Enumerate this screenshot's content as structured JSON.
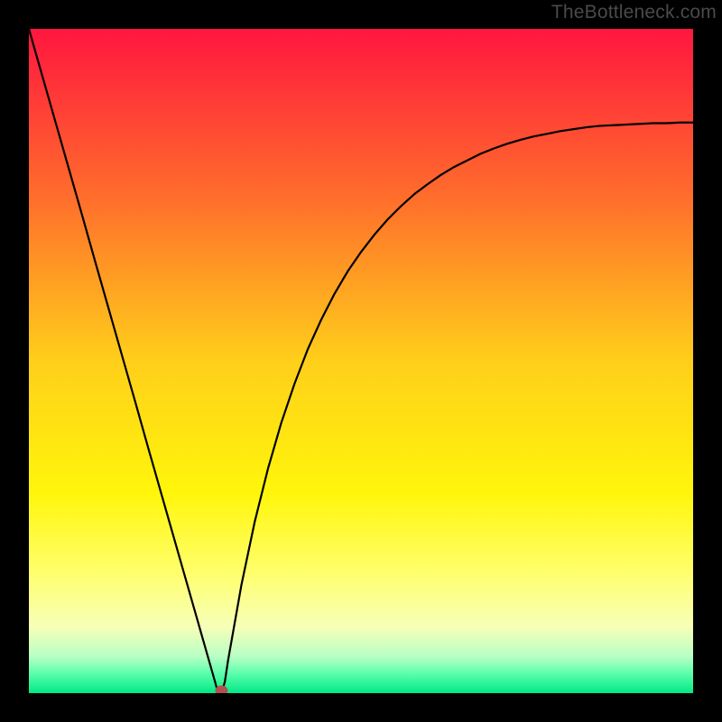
{
  "watermark": "TheBottleneck.com",
  "chart_data": {
    "type": "line",
    "title": "",
    "xlabel": "",
    "ylabel": "",
    "x": [
      0.0,
      0.02,
      0.04,
      0.06,
      0.08,
      0.1,
      0.12,
      0.14,
      0.16,
      0.18,
      0.2,
      0.22,
      0.24,
      0.26,
      0.28,
      0.285,
      0.29,
      0.295,
      0.3,
      0.32,
      0.34,
      0.36,
      0.38,
      0.4,
      0.42,
      0.44,
      0.46,
      0.48,
      0.5,
      0.52,
      0.54,
      0.56,
      0.58,
      0.6,
      0.62,
      0.64,
      0.66,
      0.68,
      0.7,
      0.72,
      0.74,
      0.76,
      0.78,
      0.8,
      0.82,
      0.84,
      0.86,
      0.88,
      0.9,
      0.92,
      0.94,
      0.96,
      0.98,
      1.0
    ],
    "values": [
      1.0,
      0.93,
      0.86,
      0.79,
      0.72,
      0.649,
      0.579,
      0.509,
      0.439,
      0.368,
      0.298,
      0.228,
      0.158,
      0.088,
      0.018,
      0.0,
      0.0,
      0.017,
      0.05,
      0.163,
      0.258,
      0.338,
      0.407,
      0.466,
      0.518,
      0.562,
      0.601,
      0.635,
      0.664,
      0.69,
      0.713,
      0.733,
      0.751,
      0.766,
      0.78,
      0.792,
      0.802,
      0.812,
      0.82,
      0.827,
      0.833,
      0.838,
      0.842,
      0.846,
      0.849,
      0.852,
      0.854,
      0.855,
      0.856,
      0.857,
      0.858,
      0.858,
      0.859,
      0.859
    ],
    "xlim": [
      0,
      1
    ],
    "ylim": [
      0,
      1
    ],
    "marker": {
      "x": 0.29,
      "y": 0.0,
      "color": "#b05050"
    },
    "background_gradient": {
      "stops": [
        {
          "pos": 0.0,
          "color": "#ff163f"
        },
        {
          "pos": 0.25,
          "color": "#ff6c2c"
        },
        {
          "pos": 0.5,
          "color": "#ffcf1a"
        },
        {
          "pos": 0.7,
          "color": "#fff60b"
        },
        {
          "pos": 0.82,
          "color": "#ffff6e"
        },
        {
          "pos": 0.9,
          "color": "#f7ffb8"
        },
        {
          "pos": 0.945,
          "color": "#b8ffc4"
        },
        {
          "pos": 0.97,
          "color": "#5dffac"
        },
        {
          "pos": 1.0,
          "color": "#00e987"
        }
      ]
    }
  }
}
